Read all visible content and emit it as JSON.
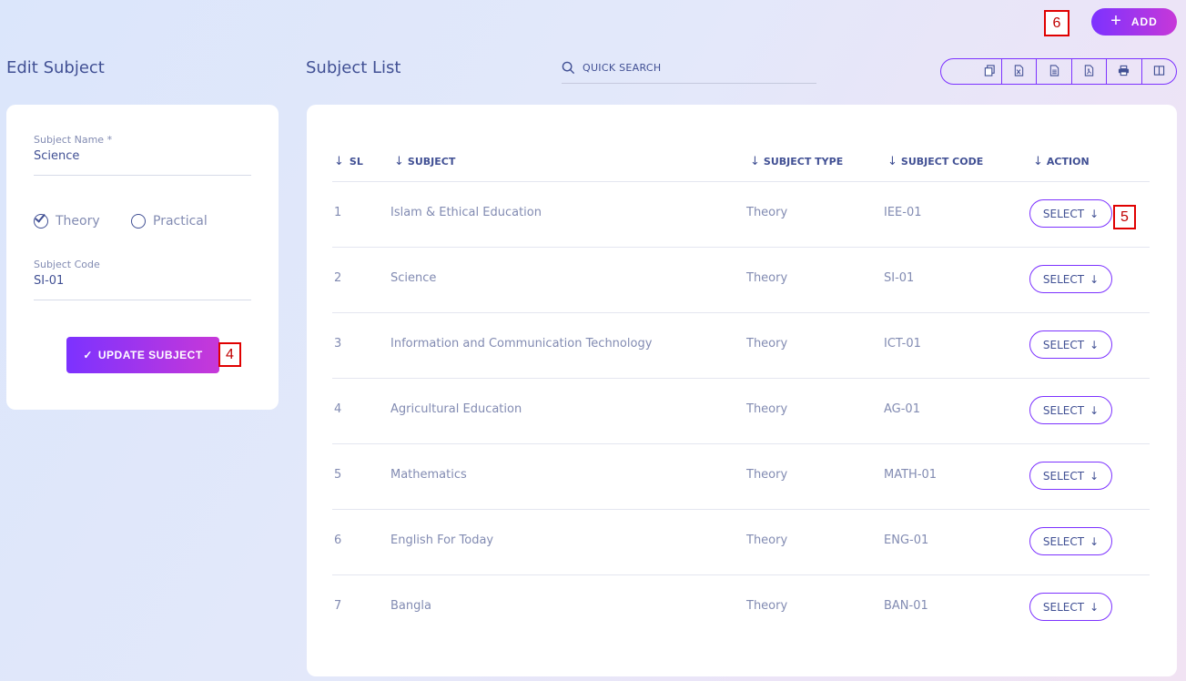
{
  "header": {
    "add_label": "ADD",
    "add_icon": "plus-icon",
    "badge_add": "6"
  },
  "edit_panel": {
    "title": "Edit Subject",
    "subject_name_label": "Subject Name *",
    "subject_name_value": "Science",
    "type_options": [
      "Theory",
      "Practical"
    ],
    "type_selected": "Theory",
    "subject_code_label": "Subject Code",
    "subject_code_value": "SI-01",
    "update_label": "UPDATE SUBJECT",
    "badge_update": "4"
  },
  "list_panel": {
    "title": "Subject List",
    "search_placeholder": "QUICK SEARCH",
    "toolbar_icons": [
      "copy-icon",
      "excel-icon",
      "csv-icon",
      "pdf-icon",
      "print-icon",
      "columns-icon"
    ],
    "columns": [
      "SL",
      "SUBJECT",
      "SUBJECT TYPE",
      "SUBJECT CODE",
      "ACTION"
    ],
    "rows": [
      {
        "sl": "1",
        "subject": "Islam & Ethical Education",
        "type": "Theory",
        "code": "IEE-01",
        "action": "SELECT"
      },
      {
        "sl": "2",
        "subject": "Science",
        "type": "Theory",
        "code": "SI-01",
        "action": "SELECT"
      },
      {
        "sl": "3",
        "subject": "Information and Communication Technology",
        "type": "Theory",
        "code": "ICT-01",
        "action": "SELECT"
      },
      {
        "sl": "4",
        "subject": "Agricultural Education",
        "type": "Theory",
        "code": "AG-01",
        "action": "SELECT"
      },
      {
        "sl": "5",
        "subject": "Mathematics",
        "type": "Theory",
        "code": "MATH-01",
        "action": "SELECT"
      },
      {
        "sl": "6",
        "subject": "English For Today",
        "type": "Theory",
        "code": "ENG-01",
        "action": "SELECT"
      },
      {
        "sl": "7",
        "subject": "Bangla",
        "type": "Theory",
        "code": "BAN-01",
        "action": "SELECT"
      }
    ],
    "badge_select": "5"
  },
  "colors": {
    "accent_start": "#7c32ff",
    "accent_end": "#c738d8",
    "text_primary": "#415094",
    "text_muted": "#828bb2",
    "badge_border": "#e00000"
  }
}
